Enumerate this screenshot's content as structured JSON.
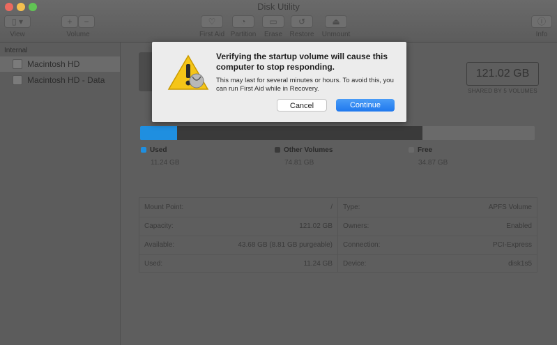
{
  "window": {
    "title": "Disk Utility"
  },
  "toolbar": {
    "view_label": "View",
    "volume_label": "Volume",
    "volume_add": "+",
    "volume_remove": "−",
    "first_aid_label": "First Aid",
    "partition_label": "Partition",
    "erase_label": "Erase",
    "restore_label": "Restore",
    "unmount_label": "Unmount",
    "info_label": "Info"
  },
  "sidebar": {
    "section": "Internal",
    "items": [
      {
        "label": "Macintosh HD",
        "selected": true
      },
      {
        "label": "Macintosh HD - Data",
        "selected": false
      }
    ]
  },
  "volume": {
    "capacity": "121.02 GB",
    "capacity_sub": "SHARED BY 5 VOLUMES"
  },
  "usage": {
    "legend": [
      {
        "name": "Used",
        "value": "11.24 GB",
        "color": "#1f8fe0"
      },
      {
        "name": "Other Volumes",
        "value": "74.81 GB",
        "color": "#3a3a3a"
      },
      {
        "name": "Free",
        "value": "34.87 GB",
        "color": "#6a6a6a"
      }
    ]
  },
  "info": {
    "left": [
      {
        "key": "Mount Point:",
        "value": "/"
      },
      {
        "key": "Capacity:",
        "value": "121.02 GB"
      },
      {
        "key": "Available:",
        "value": "43.68 GB (8.81 GB purgeable)"
      },
      {
        "key": "Used:",
        "value": "11.24 GB"
      }
    ],
    "right": [
      {
        "key": "Type:",
        "value": "APFS Volume"
      },
      {
        "key": "Owners:",
        "value": "Enabled"
      },
      {
        "key": "Connection:",
        "value": "PCI-Express"
      },
      {
        "key": "Device:",
        "value": "disk1s5"
      }
    ]
  },
  "dialog": {
    "title": "Verifying the startup volume will cause this computer to stop responding.",
    "message": "This may last for several minutes or hours. To avoid this, you can run First Aid while in Recovery.",
    "cancel_label": "Cancel",
    "continue_label": "Continue",
    "accent": "#1f78ee"
  }
}
